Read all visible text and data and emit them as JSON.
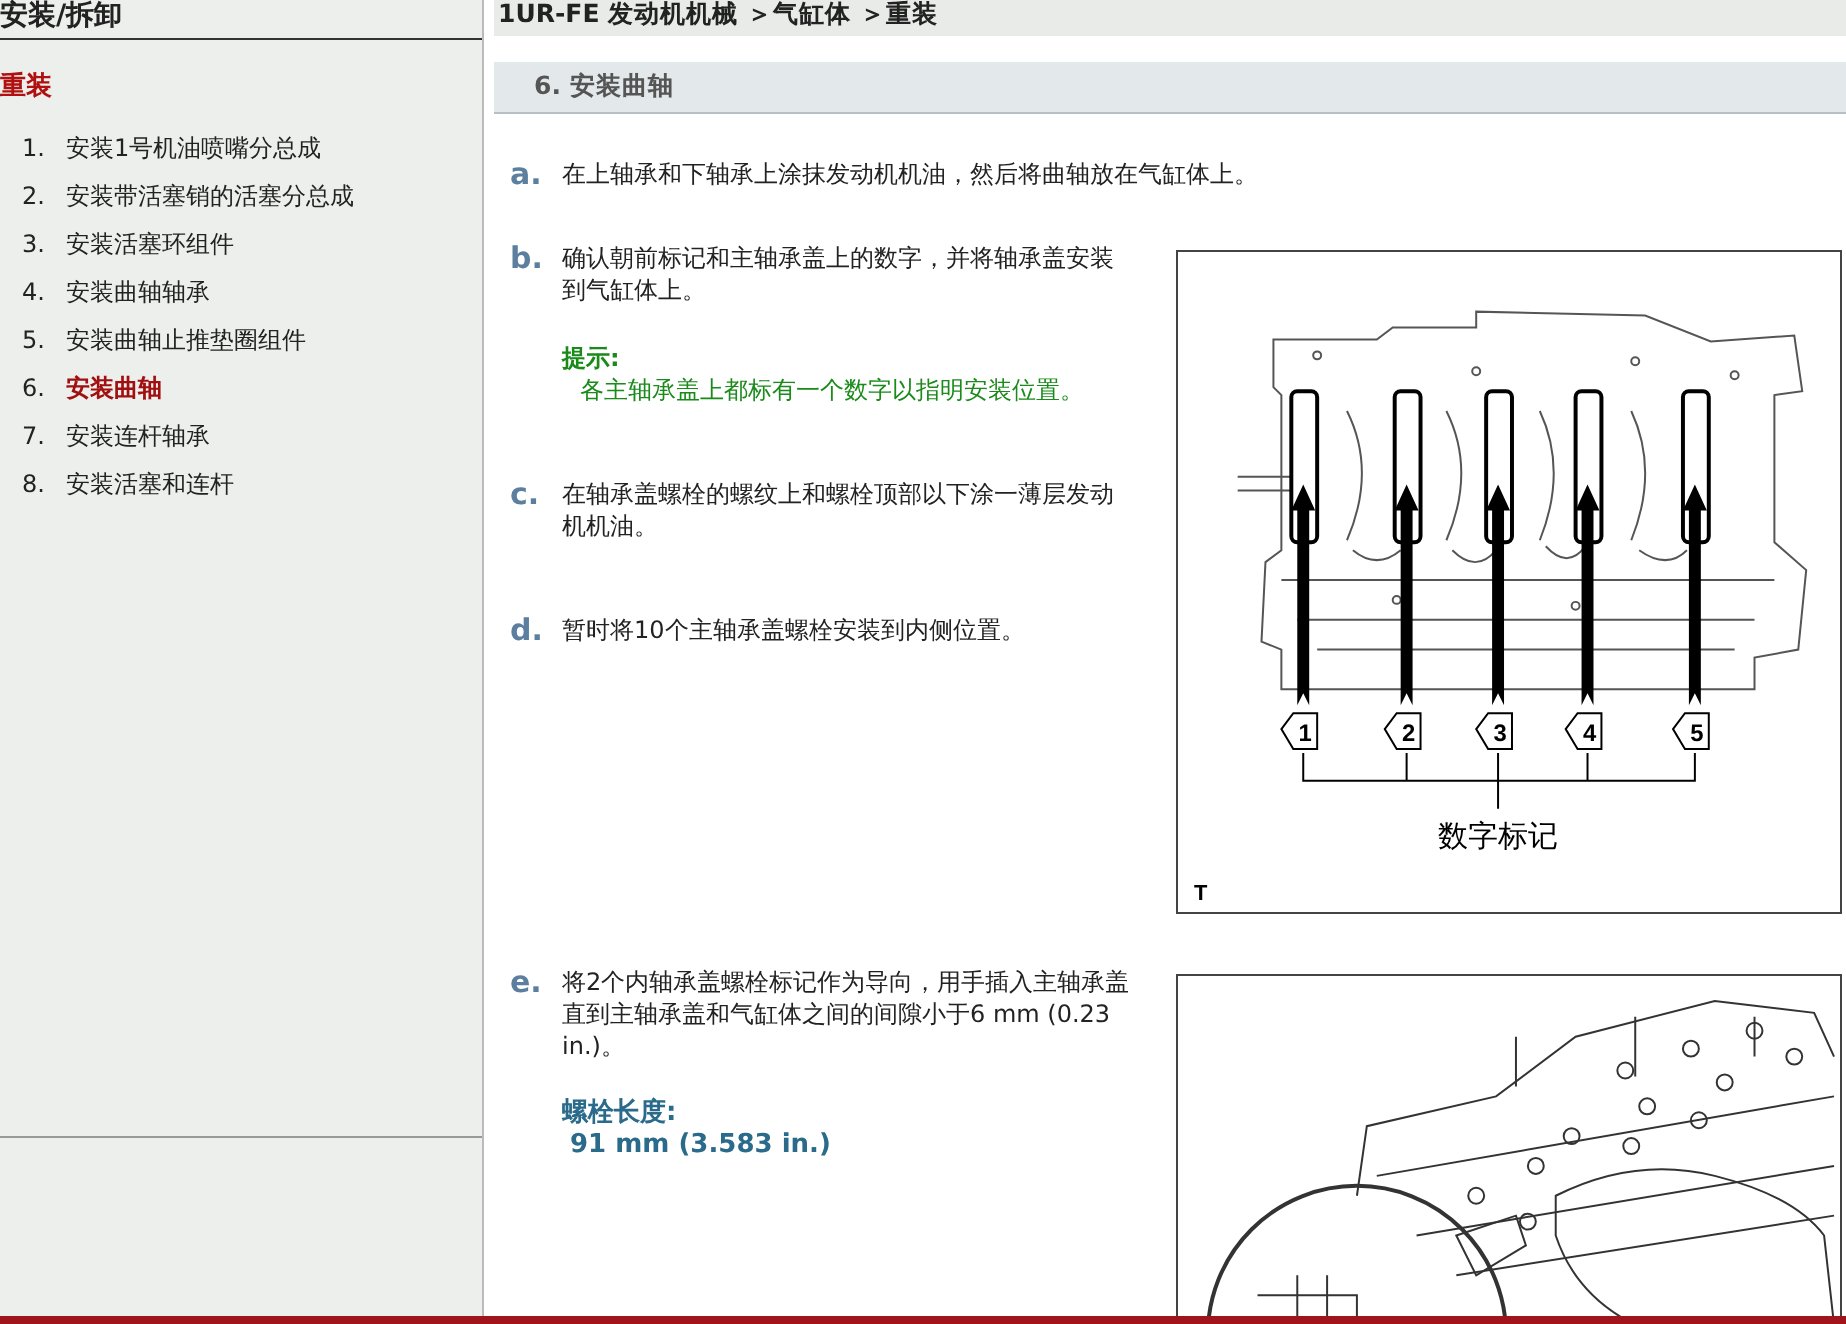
{
  "sidebar": {
    "title": "安装/拆卸",
    "section": "重装",
    "items": [
      {
        "number": "1.",
        "label": "安装1号机油喷嘴分总成",
        "selected": false
      },
      {
        "number": "2.",
        "label": "安装带活塞销的活塞分总成",
        "selected": false
      },
      {
        "number": "3.",
        "label": "安装活塞环组件",
        "selected": false
      },
      {
        "number": "4.",
        "label": "安装曲轴轴承",
        "selected": false
      },
      {
        "number": "5.",
        "label": "安装曲轴止推垫圈组件",
        "selected": false
      },
      {
        "number": "6.",
        "label": "安装曲轴",
        "selected": true
      },
      {
        "number": "7.",
        "label": "安装连杆轴承",
        "selected": false
      },
      {
        "number": "8.",
        "label": "安装活塞和连杆",
        "selected": false
      }
    ]
  },
  "breadcrumb": "1UR-FE 发动机机械 ＞气缸体 ＞重装",
  "heading": "6. 安装曲轴",
  "sections": [
    {
      "steps": [
        {
          "letter": "a.",
          "text": "在上轴承和下轴承上涂抹发动机机油，然后将曲轴放在气缸体上。"
        }
      ]
    },
    {
      "steps": [
        {
          "letter": "b.",
          "text": "确认朝前标记和主轴承盖上的数字，并将轴承盖安装到气缸体上。",
          "hint": {
            "label": "提示:",
            "text": "各主轴承盖上都标有一个数字以指明安装位置。"
          }
        },
        {
          "letter": "c.",
          "text": "在轴承盖螺栓的螺纹上和螺栓顶部以下涂一薄层发动机机油。"
        },
        {
          "letter": "d.",
          "text": "暂时将10个主轴承盖螺栓安装到内侧位置。"
        }
      ],
      "figure": {
        "kind": "bearing-caps",
        "tags": [
          "1",
          "2",
          "3",
          "4",
          "5"
        ],
        "caption": "数字标记",
        "corner": "T"
      }
    },
    {
      "steps": [
        {
          "letter": "e.",
          "text": "将2个内轴承盖螺栓标记作为导向，用手插入主轴承盖直到主轴承盖和气缸体之间的间隙小于6 mm (0.23 in.)。",
          "spec": {
            "label": "螺栓长度:",
            "value": "91 mm (3.583 in.)"
          }
        }
      ],
      "figure": {
        "kind": "cap-install"
      }
    }
  ]
}
